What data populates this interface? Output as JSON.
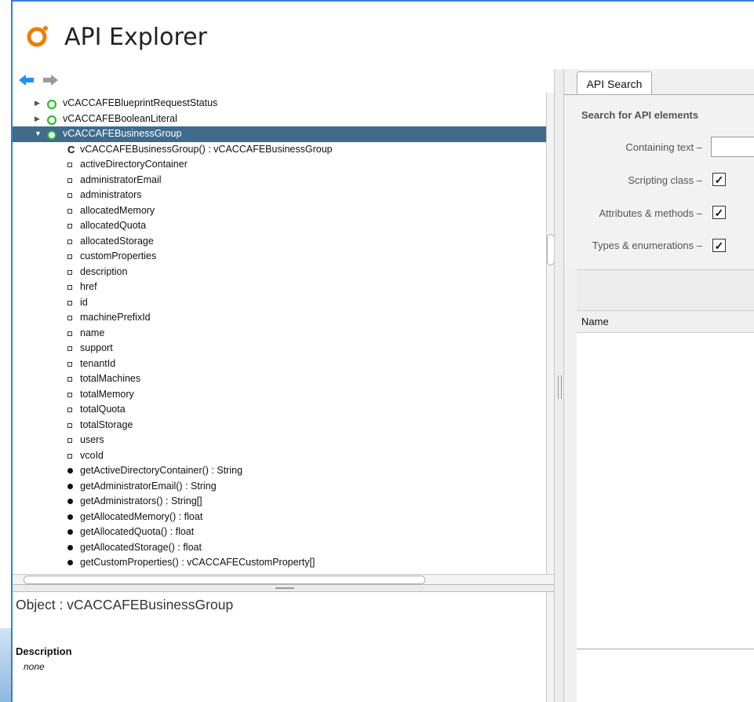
{
  "app": {
    "title": "API Explorer"
  },
  "tree": {
    "items": [
      {
        "label": "vCACCAFEBlueprintRequestStatus",
        "kind": "class",
        "expanded": false
      },
      {
        "label": "vCACCAFEBooleanLiteral",
        "kind": "class",
        "expanded": false
      },
      {
        "label": "vCACCAFEBusinessGroup",
        "kind": "class",
        "expanded": true,
        "selected": true
      },
      {
        "label": "vCACCAFEBusinessGroup() : vCACCAFEBusinessGroup",
        "kind": "constructor",
        "marker": "C"
      },
      {
        "label": "activeDirectoryContainer",
        "kind": "attribute"
      },
      {
        "label": "administratorEmail",
        "kind": "attribute"
      },
      {
        "label": "administrators",
        "kind": "attribute"
      },
      {
        "label": "allocatedMemory",
        "kind": "attribute"
      },
      {
        "label": "allocatedQuota",
        "kind": "attribute"
      },
      {
        "label": "allocatedStorage",
        "kind": "attribute"
      },
      {
        "label": "customProperties",
        "kind": "attribute"
      },
      {
        "label": "description",
        "kind": "attribute"
      },
      {
        "label": "href",
        "kind": "attribute"
      },
      {
        "label": "id",
        "kind": "attribute"
      },
      {
        "label": "machinePrefixId",
        "kind": "attribute"
      },
      {
        "label": "name",
        "kind": "attribute"
      },
      {
        "label": "support",
        "kind": "attribute"
      },
      {
        "label": "tenantId",
        "kind": "attribute"
      },
      {
        "label": "totalMachines",
        "kind": "attribute"
      },
      {
        "label": "totalMemory",
        "kind": "attribute"
      },
      {
        "label": "totalQuota",
        "kind": "attribute"
      },
      {
        "label": "totalStorage",
        "kind": "attribute"
      },
      {
        "label": "users",
        "kind": "attribute"
      },
      {
        "label": "vcoId",
        "kind": "attribute"
      },
      {
        "label": "getActiveDirectoryContainer() : String",
        "kind": "method"
      },
      {
        "label": "getAdministratorEmail() : String",
        "kind": "method"
      },
      {
        "label": "getAdministrators() : String[]",
        "kind": "method"
      },
      {
        "label": "getAllocatedMemory() : float",
        "kind": "method"
      },
      {
        "label": "getAllocatedQuota() : float",
        "kind": "method"
      },
      {
        "label": "getAllocatedStorage() : float",
        "kind": "method"
      },
      {
        "label": "getCustomProperties() : vCACCAFECustomProperty[]",
        "kind": "method"
      }
    ]
  },
  "details": {
    "object_title": "Object : vCACCAFEBusinessGroup",
    "description_heading": "Description",
    "description_value": "none"
  },
  "search": {
    "tab_label": "API Search",
    "section_heading": "Search for API elements",
    "containing_text_label": "Containing text  –",
    "containing_text_value": "",
    "options": [
      {
        "label": "Scripting class  –",
        "checked": true
      },
      {
        "label": "Attributes & methods  –",
        "checked": true
      },
      {
        "label": "Types & enumerations  –",
        "checked": true
      }
    ],
    "results_column": "Name"
  },
  "colors": {
    "selection": "#3f6b8c",
    "accent_orange": "#f07c00",
    "nav_arrow": "#1e90ff"
  }
}
